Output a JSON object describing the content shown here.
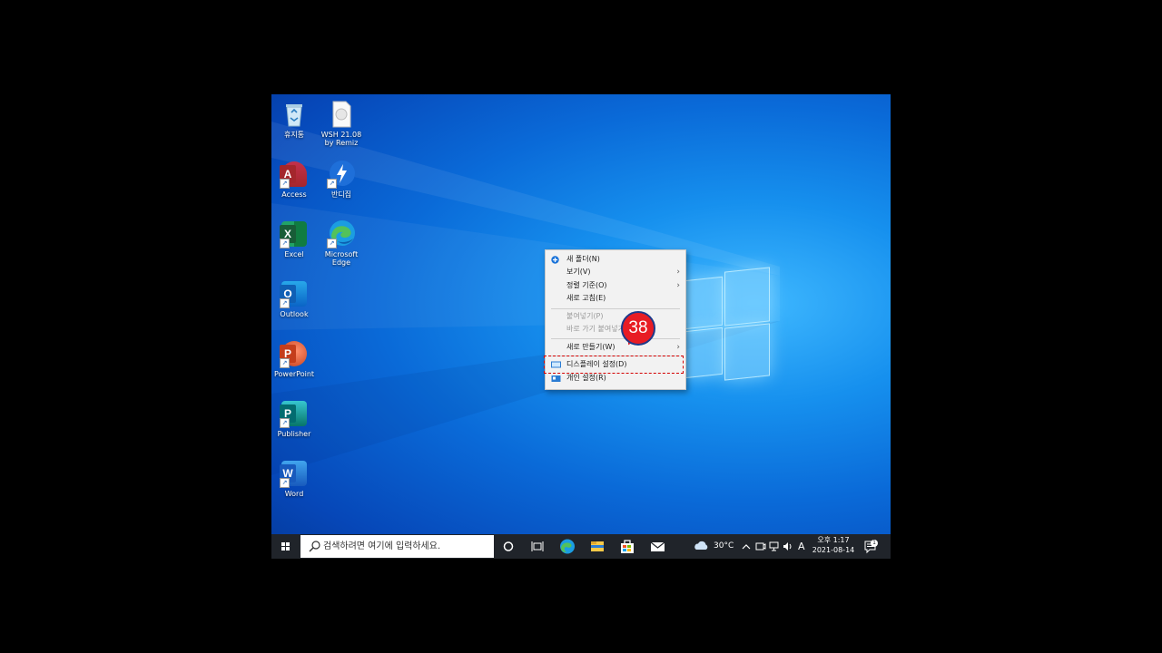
{
  "desktop": {
    "icons": [
      {
        "label": "휴지통"
      },
      {
        "label": "WSH 21.08\nby Remiz"
      },
      {
        "label": "Access"
      },
      {
        "label": "반디집"
      },
      {
        "label": "Excel"
      },
      {
        "label": "Microsoft\nEdge"
      },
      {
        "label": "Outlook"
      },
      {
        "label": "PowerPoint"
      },
      {
        "label": "Publisher"
      },
      {
        "label": "Word"
      }
    ]
  },
  "context_menu": {
    "items": [
      {
        "label": "새 폴더(N)",
        "icon": "new-folder-icon"
      },
      {
        "label": "보기(V)",
        "submenu": true
      },
      {
        "label": "정렬 기준(O)",
        "submenu": true
      },
      {
        "label": "새로 고침(E)"
      },
      {
        "label": "붙여넣기(P)",
        "disabled": true
      },
      {
        "label": "바로 가기 붙여넣기(S)",
        "disabled": true
      },
      {
        "label": "새로 만들기(W)",
        "submenu": true
      },
      {
        "label": "디스플레이 설정(D)",
        "icon": "display-icon"
      },
      {
        "label": "개인 설정(R)",
        "icon": "personalize-icon"
      }
    ]
  },
  "step_badge": {
    "number": "38",
    "color": "#e81c24"
  },
  "highlight_color": "#d40000",
  "taskbar": {
    "search_placeholder": "검색하려면 여기에 입력하세요.",
    "weather": "30°C",
    "ime": "A",
    "clock_time": "오후 1:17",
    "clock_date": "2021-08-14",
    "notification_count": "1"
  }
}
